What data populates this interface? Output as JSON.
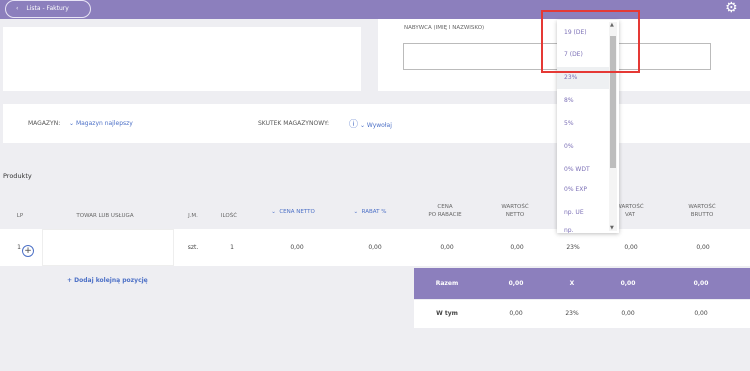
{
  "nav": {
    "back_label": "Lista - Faktury"
  },
  "buyer": {
    "label": "NABYWCA (IMIĘ I NAZWISKO)"
  },
  "warehouse": {
    "magazyn_label": "MAGAZYN:",
    "magazyn_value": "Magazyn najlepszy",
    "effect_label": "SKUTEK MAGAZYNOWY:",
    "effect_value": "Wywołaj"
  },
  "products": {
    "title": "Produkty",
    "columns": {
      "lp": "LP",
      "item": "TOWAR LUB USŁUGA",
      "unit": "J.M.",
      "qty": "ILOŚĆ",
      "net_price": "CENA NETTO",
      "discount": "RABAT %",
      "price_after_l1": "CENA",
      "price_after_l2": "PO RABACIE",
      "net_value_l1": "WARTOŚĆ",
      "net_value_l2": "NETTO",
      "vat_value_l1": "WARTOŚĆ",
      "vat_value_l2": "VAT",
      "gross_value_l1": "WARTOŚĆ",
      "gross_value_l2": "BRUTTO"
    },
    "row": {
      "lp": "1",
      "unit": "szt.",
      "qty": "1",
      "net_price": "0,00",
      "discount": "0,00",
      "price_after": "0,00",
      "net_value": "0,00",
      "vat_rate": "23%",
      "vat_value": "0,00",
      "gross_value": "0,00"
    },
    "add_row_label": "+ Dodaj kolejną pozycję"
  },
  "summary": {
    "total_label": "Razem",
    "total_net": "0,00",
    "total_rate": "X",
    "total_vat": "0,00",
    "total_gross": "0,00",
    "of_which_label": "W tym",
    "of_which_net": "0,00",
    "of_which_rate": "23%",
    "of_which_vat": "0,00",
    "of_which_gross": "0,00"
  },
  "vat_dropdown": {
    "options": [
      "19 (DE)",
      "7 (DE)",
      "23%",
      "8%",
      "5%",
      "0%",
      "0% WDT",
      "0% EXP",
      "np. UE",
      "np."
    ],
    "selected": "23%"
  },
  "colors": {
    "header": "#8c7fbd",
    "link": "#4b6fc6",
    "highlight": "#e53935"
  }
}
